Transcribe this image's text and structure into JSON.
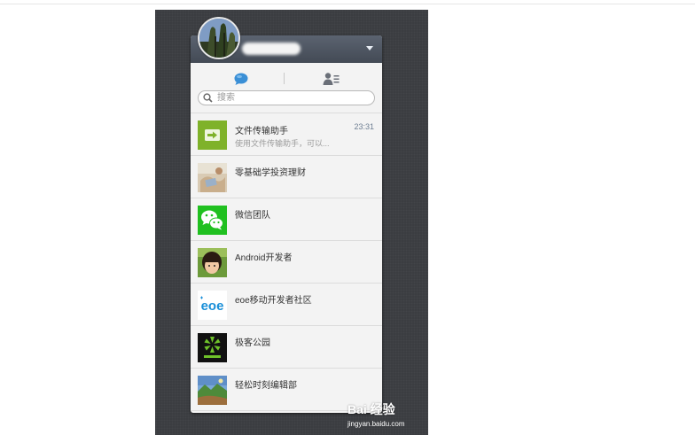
{
  "search": {
    "placeholder": "搜索"
  },
  "tabs": [
    {
      "name": "chats",
      "icon": "chat-bubble-icon"
    },
    {
      "name": "contacts",
      "icon": "contacts-icon"
    }
  ],
  "conversations": [
    {
      "name": "文件传输助手",
      "preview": "使用文件传输助手，可以...",
      "time": "23:31",
      "icon": "file-transfer-icon"
    },
    {
      "name": "零基础学投资理财",
      "icon": "photo-avatar"
    },
    {
      "name": "微信团队",
      "icon": "wechat-logo-icon"
    },
    {
      "name": "Android开发者",
      "icon": "photo-avatar"
    },
    {
      "name": "eoe移动开发者社区",
      "logo_text": "eoe",
      "icon": "eoe-logo"
    },
    {
      "name": "极客公园",
      "icon": "geekpark-logo"
    },
    {
      "name": "轻松时刻编辑部",
      "icon": "photo-avatar"
    }
  ],
  "colors": {
    "background": "#3b3d41",
    "header": "#4f5662",
    "wechat_green": "#20c020",
    "file_green": "#7fb22a"
  },
  "watermark": {
    "brand": "Bai 经验",
    "url": "jingyan.baidu.com"
  }
}
